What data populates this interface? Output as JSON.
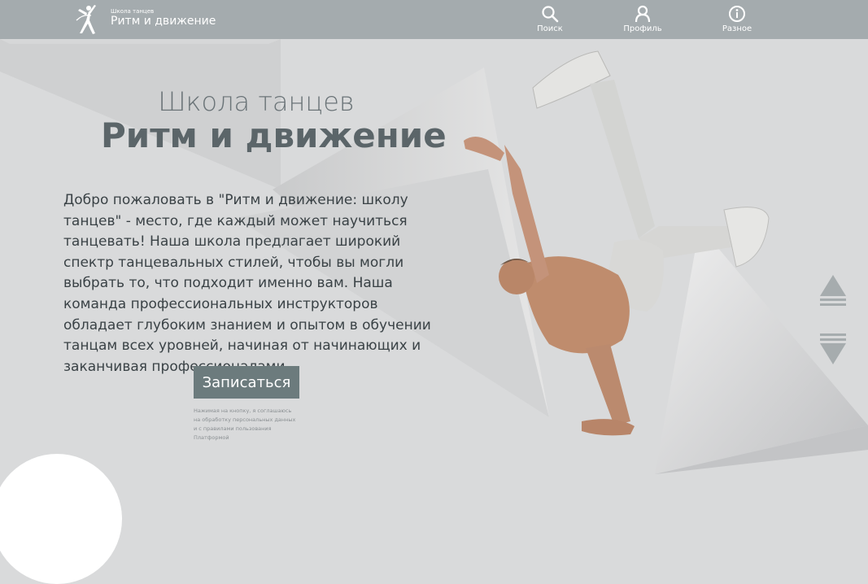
{
  "header": {
    "logo_small": "Школа танцев",
    "logo_title": "Ритм и движение",
    "nav": [
      {
        "label": "Поиск",
        "icon": "search-icon"
      },
      {
        "label": "Профиль",
        "icon": "user-icon"
      },
      {
        "label": "Разное",
        "icon": "info-icon"
      }
    ]
  },
  "hero": {
    "title_small": "Школа танцев",
    "title_big": "Ритм и движение",
    "welcome_text": "Добро пожаловать в \"Ритм и движение: школу танцев\" - место, где каждый может научиться танцевать! Наша школа предлагает широкий спектр танцевальных стилей, чтобы вы могли выбрать то, что подходит именно вам. Наша команда профессиональных инструкторов обладает глубоким знанием и опытом в обучении танцам всех уровней, начиная от начинающих и заканчивая профессионалами.",
    "signup_label": "Записаться",
    "consent_text": "Нажимая на кнопку, я соглашаюсь на обработку персональных данных и с правилами пользования Платформой"
  },
  "colors": {
    "topbar": "#a4abae",
    "background": "#d9dadb",
    "button": "#6c7b7d",
    "title": "#5b6569"
  }
}
